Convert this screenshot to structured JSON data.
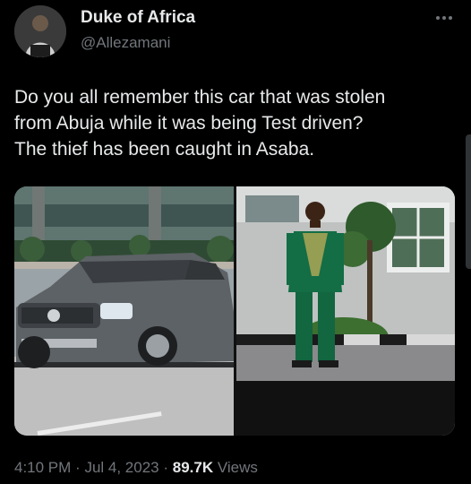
{
  "tweet": {
    "author": {
      "display_name": "Duke of Africa",
      "handle": "@Allezamani"
    },
    "text": "Do you all remember this car that was stolen\nfrom Abuja while it was being Test driven?\nThe thief has been caught in Asaba.",
    "media": [
      {
        "kind": "photo",
        "subject": "grey SUV"
      },
      {
        "kind": "photo",
        "subject": "man in green native attire"
      }
    ],
    "meta": {
      "time": "4:10 PM",
      "date": "Jul 4, 2023",
      "views_count": "89.7K",
      "views_label": "Views"
    }
  },
  "icons": {
    "more": "more-dots-icon"
  }
}
